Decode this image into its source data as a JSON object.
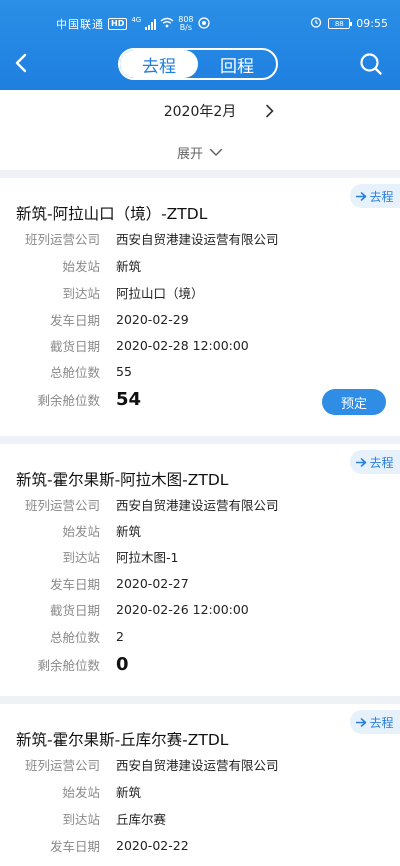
{
  "status_bar": {
    "carrier": "中国联通",
    "hd": "HD",
    "network": "4G",
    "speed_value": "808",
    "speed_unit": "B/s",
    "battery": "88",
    "time": "09:55"
  },
  "nav": {
    "tabs": [
      {
        "label": "去程",
        "active": true
      },
      {
        "label": "回程",
        "active": false
      }
    ]
  },
  "calendar": {
    "month": "2020年2月",
    "expand_label": "展开"
  },
  "trains": [
    {
      "direction": "去程",
      "route": "新筑-阿拉山口（境）-ZTDL",
      "fields": [
        {
          "label": "班列运营公司",
          "value": "西安自贸港建设运营有限公司"
        },
        {
          "label": "始发站",
          "value": "新筑"
        },
        {
          "label": "到达站",
          "value": "阿拉山口（境）"
        },
        {
          "label": "发车日期",
          "value": "2020-02-29"
        },
        {
          "label": "截货日期",
          "value": "2020-02-28 12:00:00"
        },
        {
          "label": "总舱位数",
          "value": "55"
        },
        {
          "label": "剩余舱位数",
          "value": "54"
        }
      ],
      "book_label": "预定"
    },
    {
      "direction": "去程",
      "route": "新筑-霍尔果斯-阿拉木图-ZTDL",
      "fields": [
        {
          "label": "班列运营公司",
          "value": "西安自贸港建设运营有限公司"
        },
        {
          "label": "始发站",
          "value": "新筑"
        },
        {
          "label": "到达站",
          "value": "阿拉木图-1"
        },
        {
          "label": "发车日期",
          "value": "2020-02-27"
        },
        {
          "label": "截货日期",
          "value": "2020-02-26 12:00:00"
        },
        {
          "label": "总舱位数",
          "value": "2"
        },
        {
          "label": "剩余舱位数",
          "value": "0"
        }
      ]
    },
    {
      "direction": "去程",
      "route": "新筑-霍尔果斯-丘库尔赛-ZTDL",
      "fields": [
        {
          "label": "班列运营公司",
          "value": "西安自贸港建设运营有限公司"
        },
        {
          "label": "始发站",
          "value": "新筑"
        },
        {
          "label": "到达站",
          "value": "丘库尔赛"
        },
        {
          "label": "发车日期",
          "value": "2020-02-22"
        }
      ]
    }
  ],
  "colors": {
    "header": "#1f7fe0",
    "accent": "#2f8de6",
    "tag_bg": "#e7f1fb",
    "page_bg": "#eef1f5"
  }
}
